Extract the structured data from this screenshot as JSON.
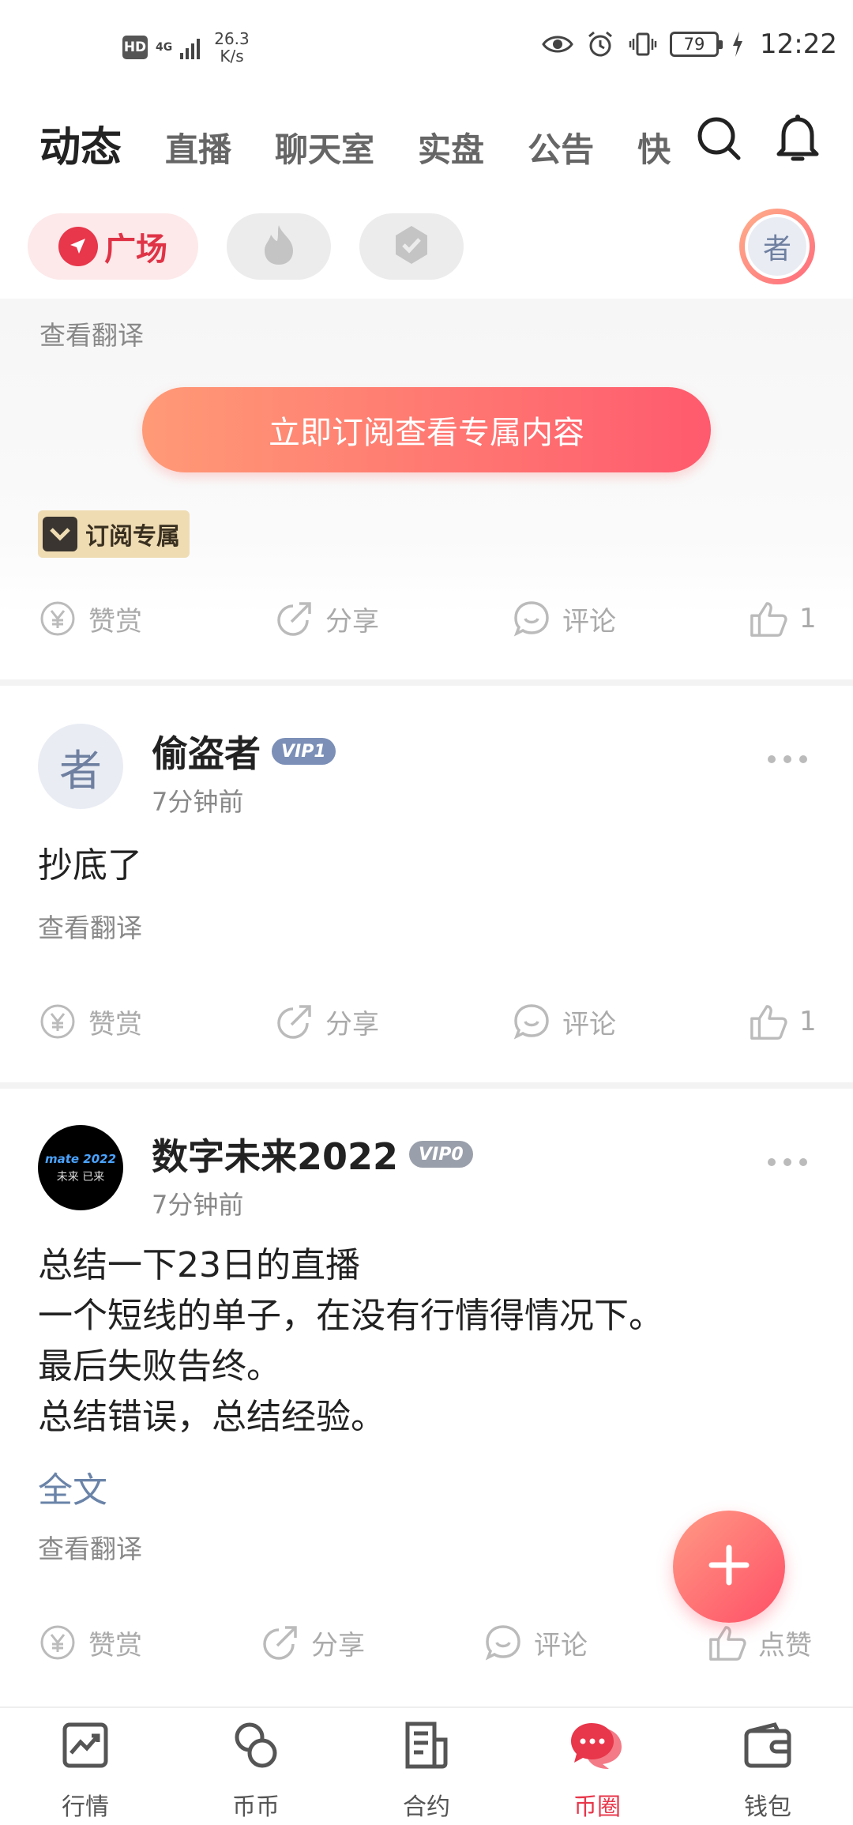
{
  "status_bar": {
    "hd": "HD",
    "network": "4G",
    "speed_value": "26.3",
    "speed_unit": "K/s",
    "battery": "79",
    "time": "12:22"
  },
  "top_nav": {
    "tabs": [
      "动态",
      "直播",
      "聊天室",
      "实盘",
      "公告",
      "快讯"
    ],
    "active_tab": "动态"
  },
  "filters": {
    "plaza_label": "广场",
    "hot_icon": "flame-icon",
    "verified_icon": "shield-check-icon",
    "user_avatar_glyph": "者"
  },
  "post_subscription": {
    "translate": "查看翻译",
    "subscribe_button": "立即订阅查看专属内容",
    "badge": "订阅专属",
    "actions": {
      "tip": "赞赏",
      "share": "分享",
      "comment": "评论",
      "like_count": "1"
    }
  },
  "posts": [
    {
      "avatar_glyph": "者",
      "name": "偷盗者",
      "vip": "VIP1",
      "time": "7分钟前",
      "text": "抄底了",
      "translate": "查看翻译",
      "actions": {
        "tip": "赞赏",
        "share": "分享",
        "comment": "评论",
        "like_count": "1"
      }
    },
    {
      "avatar_line1": "mate 2022",
      "avatar_line2": "未来 已来",
      "name": "数字未来2022",
      "vip": "VIP0",
      "time": "7分钟前",
      "text": "总结一下23日的直播\n一个短线的单子，在没有行情得情况下。\n最后失败告终。\n总结错误，总结经验。",
      "full_text": "全文",
      "translate": "查看翻译",
      "actions": {
        "tip": "赞赏",
        "share": "分享",
        "comment": "评论",
        "like": "点赞"
      }
    }
  ],
  "bottom_nav": {
    "items": [
      "行情",
      "币币",
      "合约",
      "币圈",
      "钱包"
    ],
    "active": "币圈"
  },
  "colors": {
    "accent": "#e8364a",
    "vip1": "#7b8fb7",
    "link": "#6a83a8"
  }
}
